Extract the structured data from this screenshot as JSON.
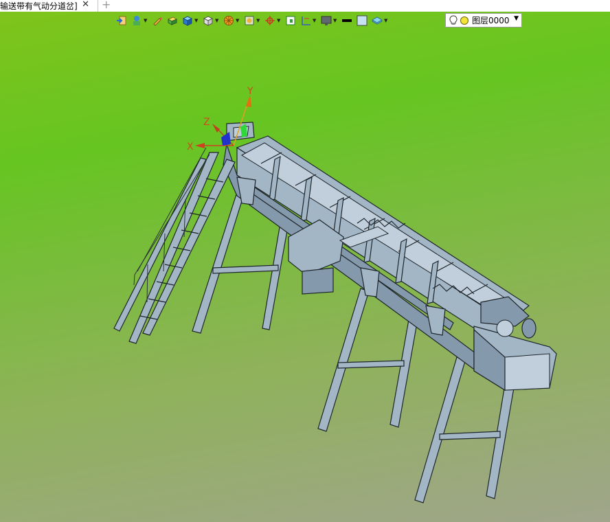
{
  "tab": {
    "title": "输送带有气动分道岔]",
    "close_glyph": "✕",
    "add_glyph": "+"
  },
  "toolbar": {
    "buttons": [
      "exit-icon",
      "render-style-icon",
      "pencil-icon",
      "box-tool-icon",
      "cube-blue-icon",
      "cube-white-icon",
      "section-wheel-icon",
      "view-orient-icon",
      "origin-icon",
      "sketch-icon",
      "dimension-icon",
      "display-icon",
      "line-color-icon",
      "fill-color-icon",
      "layer-stack-icon"
    ],
    "layer": {
      "name": "图层0000"
    }
  },
  "axes": {
    "x": "X",
    "y": "Y",
    "z": "Z"
  },
  "colors": {
    "viewport_top": "#7fc41c",
    "viewport_bottom": "#a0a58c",
    "steel": "#9fb2c2",
    "edge": "#1c2228"
  }
}
